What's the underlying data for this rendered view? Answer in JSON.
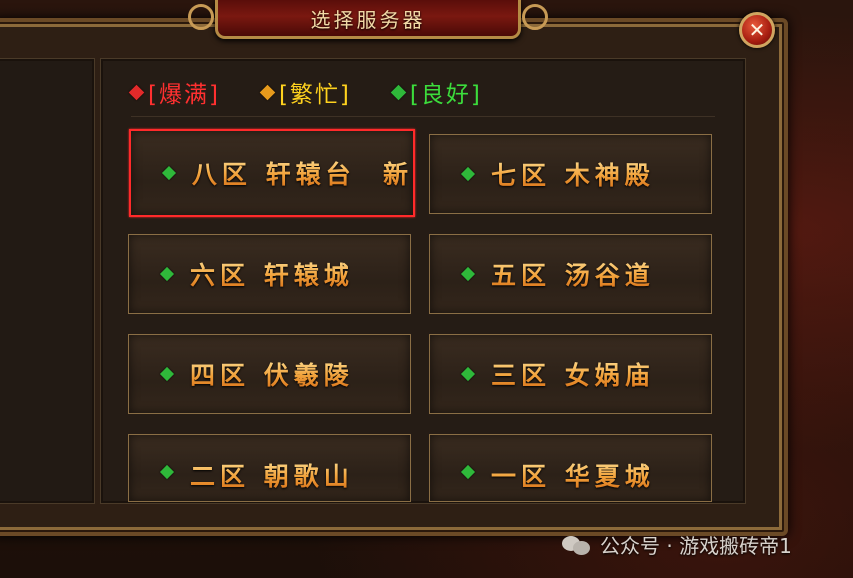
{
  "title": "选择服务器",
  "close_label": "✕",
  "legend": [
    {
      "label": "[爆满]",
      "color": "#ff3030",
      "gem_color": "#e22a2a"
    },
    {
      "label": "[繁忙]",
      "color": "#ffd21e",
      "gem_color": "#e79a1c"
    },
    {
      "label": "[良好]",
      "color": "#3cdc3c",
      "gem_color": "#2fb83a"
    }
  ],
  "servers": [
    {
      "name": "八区 轩辕台  新",
      "status": "良好",
      "selected": true
    },
    {
      "name": "七区 木神殿",
      "status": "良好",
      "selected": false
    },
    {
      "name": "六区 轩辕城",
      "status": "良好",
      "selected": false
    },
    {
      "name": "五区 汤谷道",
      "status": "良好",
      "selected": false
    },
    {
      "name": "四区 伏羲陵",
      "status": "良好",
      "selected": false
    },
    {
      "name": "三区 女娲庙",
      "status": "良好",
      "selected": false
    },
    {
      "name": "二区 朝歌山",
      "status": "良好",
      "selected": false
    },
    {
      "name": "一区 华夏城",
      "status": "良好",
      "selected": false
    }
  ],
  "watermark": "公众号 · 游戏搬砖帝1"
}
